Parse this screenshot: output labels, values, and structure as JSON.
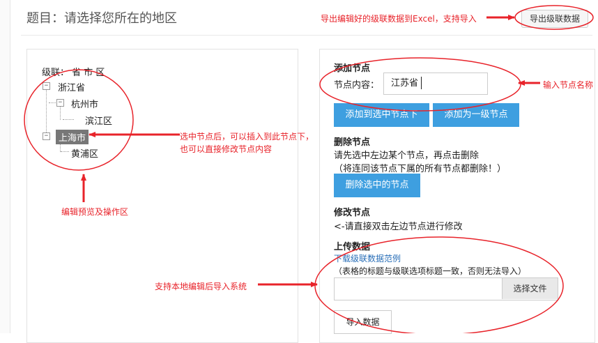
{
  "header": {
    "title": "题目：请选择您所在的地区",
    "export_label": "导出级联数据"
  },
  "tree": {
    "cascade_label": "级联： 省 市 区",
    "nodes": {
      "zhejiang": "浙江省",
      "hangzhou": "杭州市",
      "binjiang": "滨江区",
      "shanghai": "上海市",
      "huangpu": "黄浦区"
    },
    "toggle_expanded": "−"
  },
  "add_node": {
    "title": "添加节点",
    "content_label": "节点内容：",
    "content_value": "江苏省",
    "add_to_selected": "添加到选中节点下",
    "add_top_level": "添加为一级节点"
  },
  "delete_node": {
    "title": "删除节点",
    "hint": "请先选中左边某个节点，再点击删除",
    "warning": "（将连同该节点下属的所有节点都删除！）",
    "button": "删除选中的节点"
  },
  "edit_node": {
    "title": "修改节点",
    "hint": "<-请直接双击左边节点进行修改"
  },
  "upload": {
    "title": "上传数据",
    "download_link": "下载级联数据范例",
    "note": "（表格的标题与级联选项标题一致，否则无法导入）",
    "file_value": "",
    "choose_file": "选择文件",
    "import_button": "导入数据"
  },
  "annotations": {
    "export_note": "导出编辑好的级联数据到Excel，支持导入",
    "input_note": "输入节点名称",
    "select_note_1": "选中节点后，可以插入到此节点下，",
    "select_note_2": "也可以直接修改节点内容",
    "preview_note": "编辑预览及操作区",
    "upload_note": "支持本地编辑后导入系统"
  },
  "colors": {
    "accent_red": "#e8232a",
    "button_blue": "#3e9fe0",
    "selected_node": "#777777",
    "link_blue": "#2a6fb8"
  }
}
